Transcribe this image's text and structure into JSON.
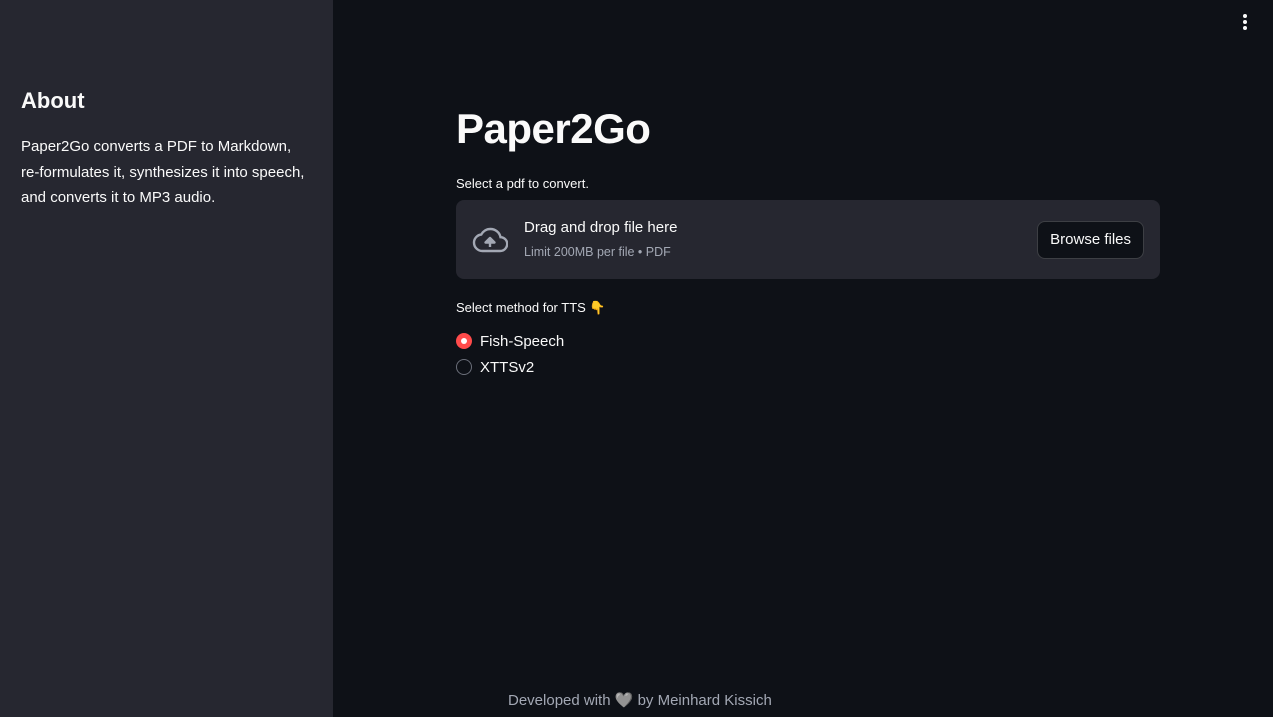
{
  "sidebar": {
    "heading": "About",
    "description": "Paper2Go converts a PDF to Markdown, re-formulates it, synthesizes it into speech, and converts it to MP3 audio."
  },
  "main": {
    "title": "Paper2Go",
    "uploader": {
      "label": "Select a pdf to convert.",
      "drop_text": "Drag and drop file here",
      "limit_text": "Limit 200MB per file • PDF",
      "browse_label": "Browse files"
    },
    "tts": {
      "label": "Select method for TTS 👇",
      "options": [
        {
          "label": "Fish-Speech",
          "selected": true
        },
        {
          "label": "XTTSv2",
          "selected": false
        }
      ]
    }
  },
  "footer": {
    "text": "Developed with 🩶 by Meinhard Kissich"
  },
  "colors": {
    "background": "#0e1117",
    "sidebar": "#262730",
    "accent": "#ff4b4b"
  }
}
